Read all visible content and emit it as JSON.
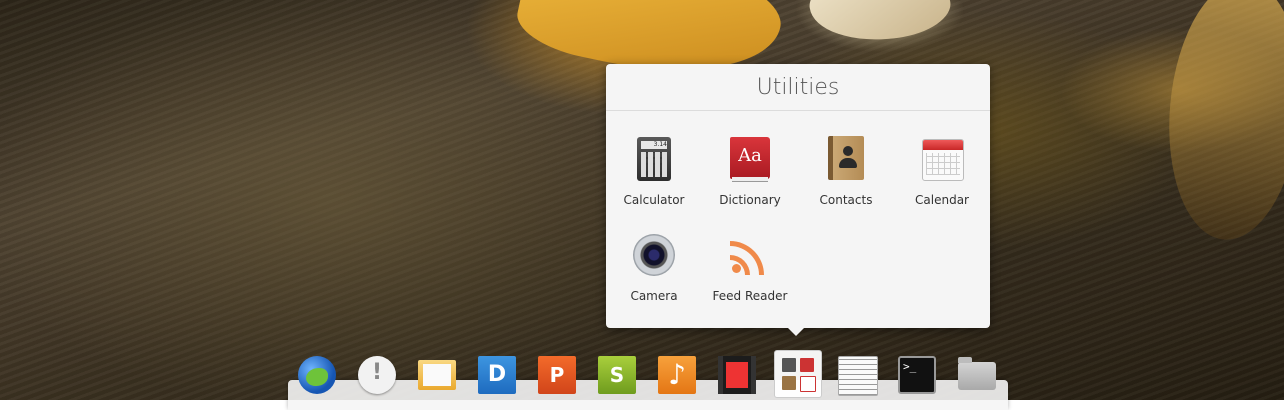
{
  "popover": {
    "title": "Utilities",
    "apps": [
      {
        "label": "Calculator",
        "icon": "calculator-icon",
        "screen": "3.14"
      },
      {
        "label": "Dictionary",
        "icon": "dictionary-icon",
        "glyph": "Aa"
      },
      {
        "label": "Contacts",
        "icon": "contacts-icon"
      },
      {
        "label": "Calendar",
        "icon": "calendar-icon"
      },
      {
        "label": "Camera",
        "icon": "camera-icon"
      },
      {
        "label": "Feed Reader",
        "icon": "feed-reader-icon"
      }
    ]
  },
  "dock": {
    "items": [
      {
        "icon": "web-browser-icon"
      },
      {
        "icon": "chat-icon",
        "glyph": "!"
      },
      {
        "icon": "mail-icon"
      },
      {
        "icon": "document-editor-icon",
        "glyph": "D"
      },
      {
        "icon": "presentation-icon",
        "glyph": "P"
      },
      {
        "icon": "spreadsheet-icon",
        "glyph": "S"
      },
      {
        "icon": "music-icon",
        "glyph": "♪"
      },
      {
        "icon": "video-player-icon"
      },
      {
        "icon": "utilities-folder-icon",
        "active": true
      },
      {
        "icon": "text-editor-icon"
      },
      {
        "icon": "terminal-icon",
        "glyph": ">_"
      },
      {
        "icon": "home-folder-icon"
      }
    ]
  },
  "colors": {
    "popover_bg": "#f5f5f5",
    "calendar_red": "#c82828",
    "dictionary_red": "#a91a22",
    "feed_orange": "#f08a4a"
  }
}
